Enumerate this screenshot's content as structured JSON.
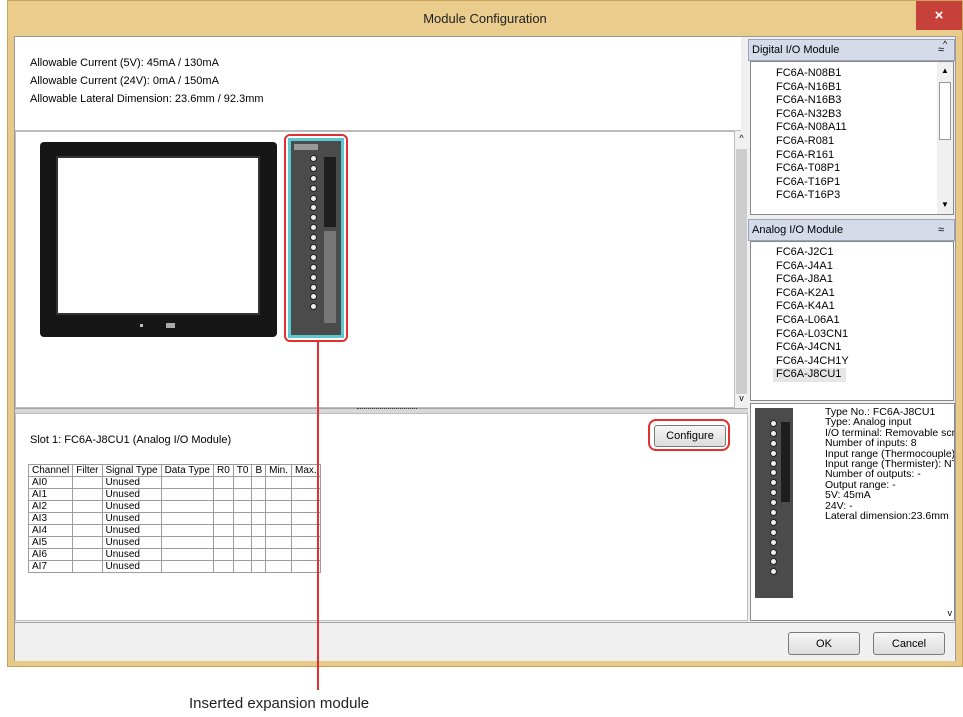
{
  "window": {
    "title": "Module Configuration",
    "close_glyph": "×"
  },
  "info": {
    "lines": [
      "Allowable Current (5V): 45mA / 130mA",
      "Allowable Current (24V): 0mA / 150mA",
      "Allowable Lateral Dimension: 23.6mm / 92.3mm"
    ]
  },
  "slot": {
    "title": "Slot 1: FC6A-J8CU1 (Analog I/O Module)",
    "configure_label": "Configure",
    "table": {
      "headers": [
        "Channel",
        "Filter",
        "Signal Type",
        "Data Type",
        "R0",
        "T0",
        "B",
        "Min.",
        "Max."
      ],
      "rows": [
        [
          "AI0",
          "",
          "Unused",
          "",
          "",
          "",
          "",
          "",
          ""
        ],
        [
          "AI1",
          "",
          "Unused",
          "",
          "",
          "",
          "",
          "",
          ""
        ],
        [
          "AI2",
          "",
          "Unused",
          "",
          "",
          "",
          "",
          "",
          ""
        ],
        [
          "AI3",
          "",
          "Unused",
          "",
          "",
          "",
          "",
          "",
          ""
        ],
        [
          "AI4",
          "",
          "Unused",
          "",
          "",
          "",
          "",
          "",
          ""
        ],
        [
          "AI5",
          "",
          "Unused",
          "",
          "",
          "",
          "",
          "",
          ""
        ],
        [
          "AI6",
          "",
          "Unused",
          "",
          "",
          "",
          "",
          "",
          ""
        ],
        [
          "AI7",
          "",
          "Unused",
          "",
          "",
          "",
          "",
          "",
          ""
        ]
      ]
    }
  },
  "digital_group": {
    "header": "Digital I/O Module",
    "collapse_glyph": "≈",
    "items": [
      "FC6A-N08B1",
      "FC6A-N16B1",
      "FC6A-N16B3",
      "FC6A-N32B3",
      "FC6A-N08A11",
      "FC6A-R081",
      "FC6A-R161",
      "FC6A-T08P1",
      "FC6A-T16P1",
      "FC6A-T16P3"
    ]
  },
  "analog_group": {
    "header": "Analog I/O Module",
    "collapse_glyph": "≈",
    "items": [
      "FC6A-J2C1",
      "FC6A-J4A1",
      "FC6A-J8A1",
      "FC6A-K2A1",
      "FC6A-K4A1",
      "FC6A-L06A1",
      "FC6A-L03CN1",
      "FC6A-J4CN1",
      "FC6A-J4CH1Y",
      "FC6A-J8CU1"
    ],
    "selected": "FC6A-J8CU1"
  },
  "details": {
    "lines": [
      "Type No.: FC6A-J8CU1",
      "Type: Analog input",
      "I/O terminal: Removable scr",
      "Number of inputs: 8",
      "Input range (Thermocouple)",
      "Input range (Thermister): NT",
      "Number of outputs: -",
      "Output range: -",
      "5V: 45mA",
      "24V: -",
      "Lateral dimension:23.6mm"
    ]
  },
  "footer": {
    "ok_label": "OK",
    "cancel_label": "Cancel"
  },
  "annotation": {
    "caption": "Inserted expansion module"
  },
  "colors": {
    "title_bar": "#eacc8d",
    "highlight": "#e03030",
    "module_selected": "#5ec8d0"
  }
}
